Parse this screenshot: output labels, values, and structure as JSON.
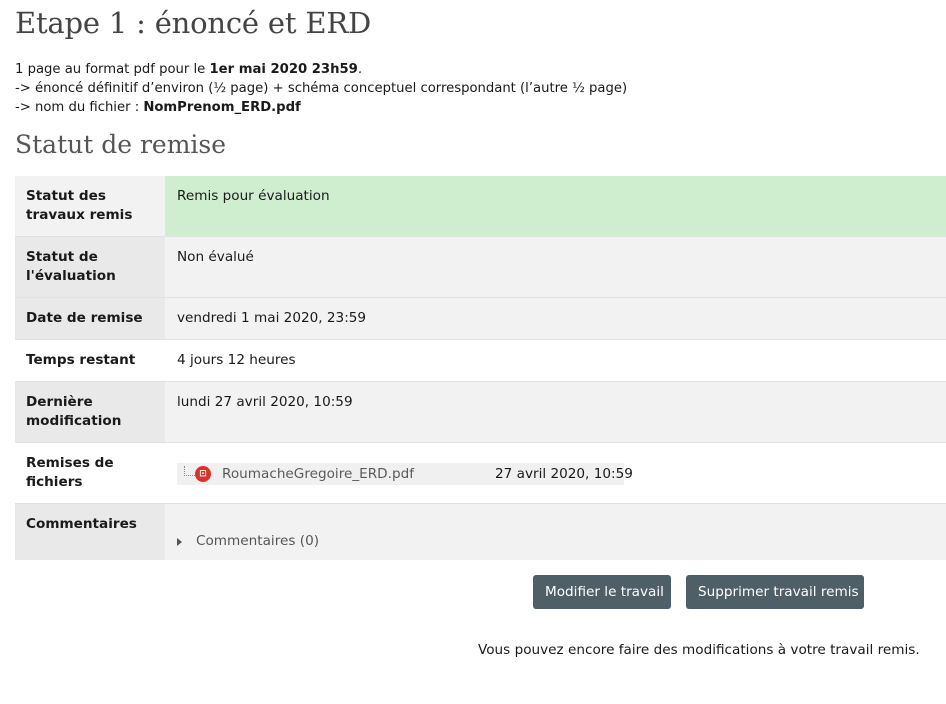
{
  "heading": "Etape 1 : énoncé et ERD",
  "intro": {
    "line1_prefix": "1 page au format pdf pour le ",
    "line1_bold": "1er mai 2020 23h59",
    "line1_suffix": ".",
    "line2": "-> énoncé définitif d’environ (½ page) + schéma conceptuel correspondant (l’autre ½ page)",
    "line3_prefix": "-> nom du fichier : ",
    "line3_bold": "NomPrenom_ERD.pdf"
  },
  "status_heading": "Statut de remise",
  "rows": [
    {
      "label": "Statut des travaux remis",
      "value": "Remis pour évaluation"
    },
    {
      "label": "Statut de l'évaluation",
      "value": "Non évalué"
    },
    {
      "label": "Date de remise",
      "value": "vendredi 1 mai 2020, 23:59"
    },
    {
      "label": "Temps restant",
      "value": "4 jours 12 heures"
    },
    {
      "label": "Dernière modification",
      "value": "lundi 27 avril 2020, 10:59"
    },
    {
      "label": "Remises de fichiers",
      "value": ""
    },
    {
      "label": "Commentaires",
      "value": ""
    }
  ],
  "file": {
    "name": "RoumacheGregoire_ERD.pdf",
    "date": "27 avril 2020, 10:59",
    "icon": "pdf-icon"
  },
  "comments_link": "Commentaires (0)",
  "buttons": {
    "edit": "Modifier le travail",
    "delete": "Supprimer travail remis"
  },
  "note": "Vous pouvez encore faire des modifications à votre travail remis.",
  "colors": {
    "success_bg": "#cfeed0",
    "button_bg": "#4e5f68",
    "pdf_icon": "#d9322b"
  }
}
